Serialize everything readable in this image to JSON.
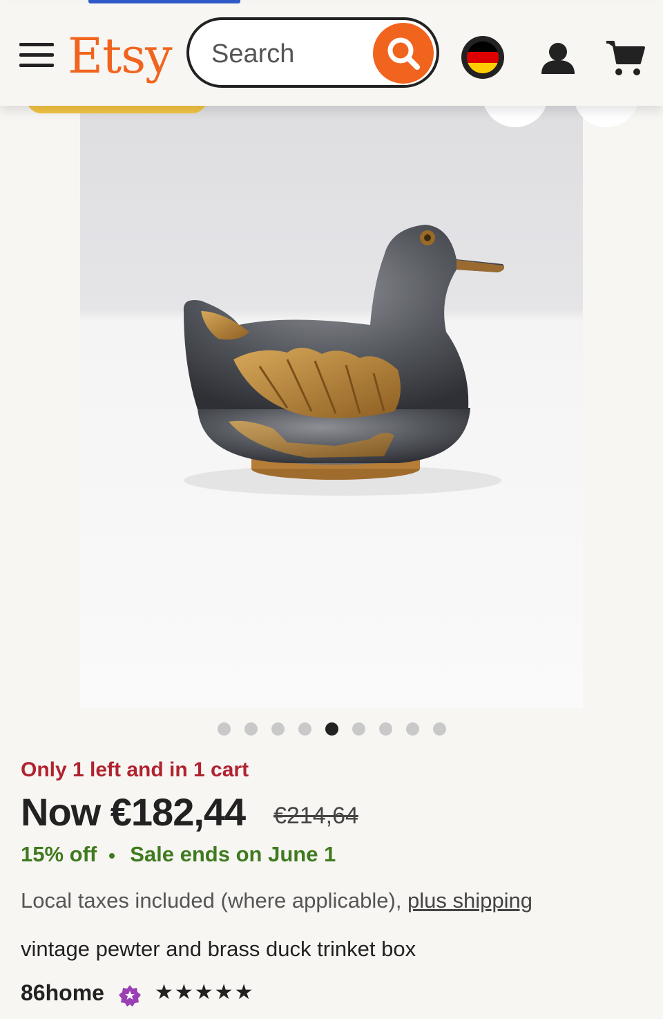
{
  "header": {
    "logo": "Etsy",
    "search_placeholder": "Search"
  },
  "carousel": {
    "total_images": 9,
    "active_index": 4
  },
  "listing": {
    "stock_message": "Only 1 left and in 1 cart",
    "price": "Now €182,44",
    "original_price": "€214,64",
    "discount": "15% off",
    "sale_end": "Sale ends on June 1",
    "tax_note": "Local taxes included (where applicable), ",
    "shipping_link": "plus shipping",
    "title": "vintage pewter and brass duck trinket box",
    "shop_name": "86home",
    "rating_stars": "★★★★★"
  },
  "colors": {
    "brand_orange": "#f1641e",
    "stock_red": "#b12330",
    "sale_green": "#3f7a1f",
    "star_seller_purple": "#9b3fb5"
  }
}
